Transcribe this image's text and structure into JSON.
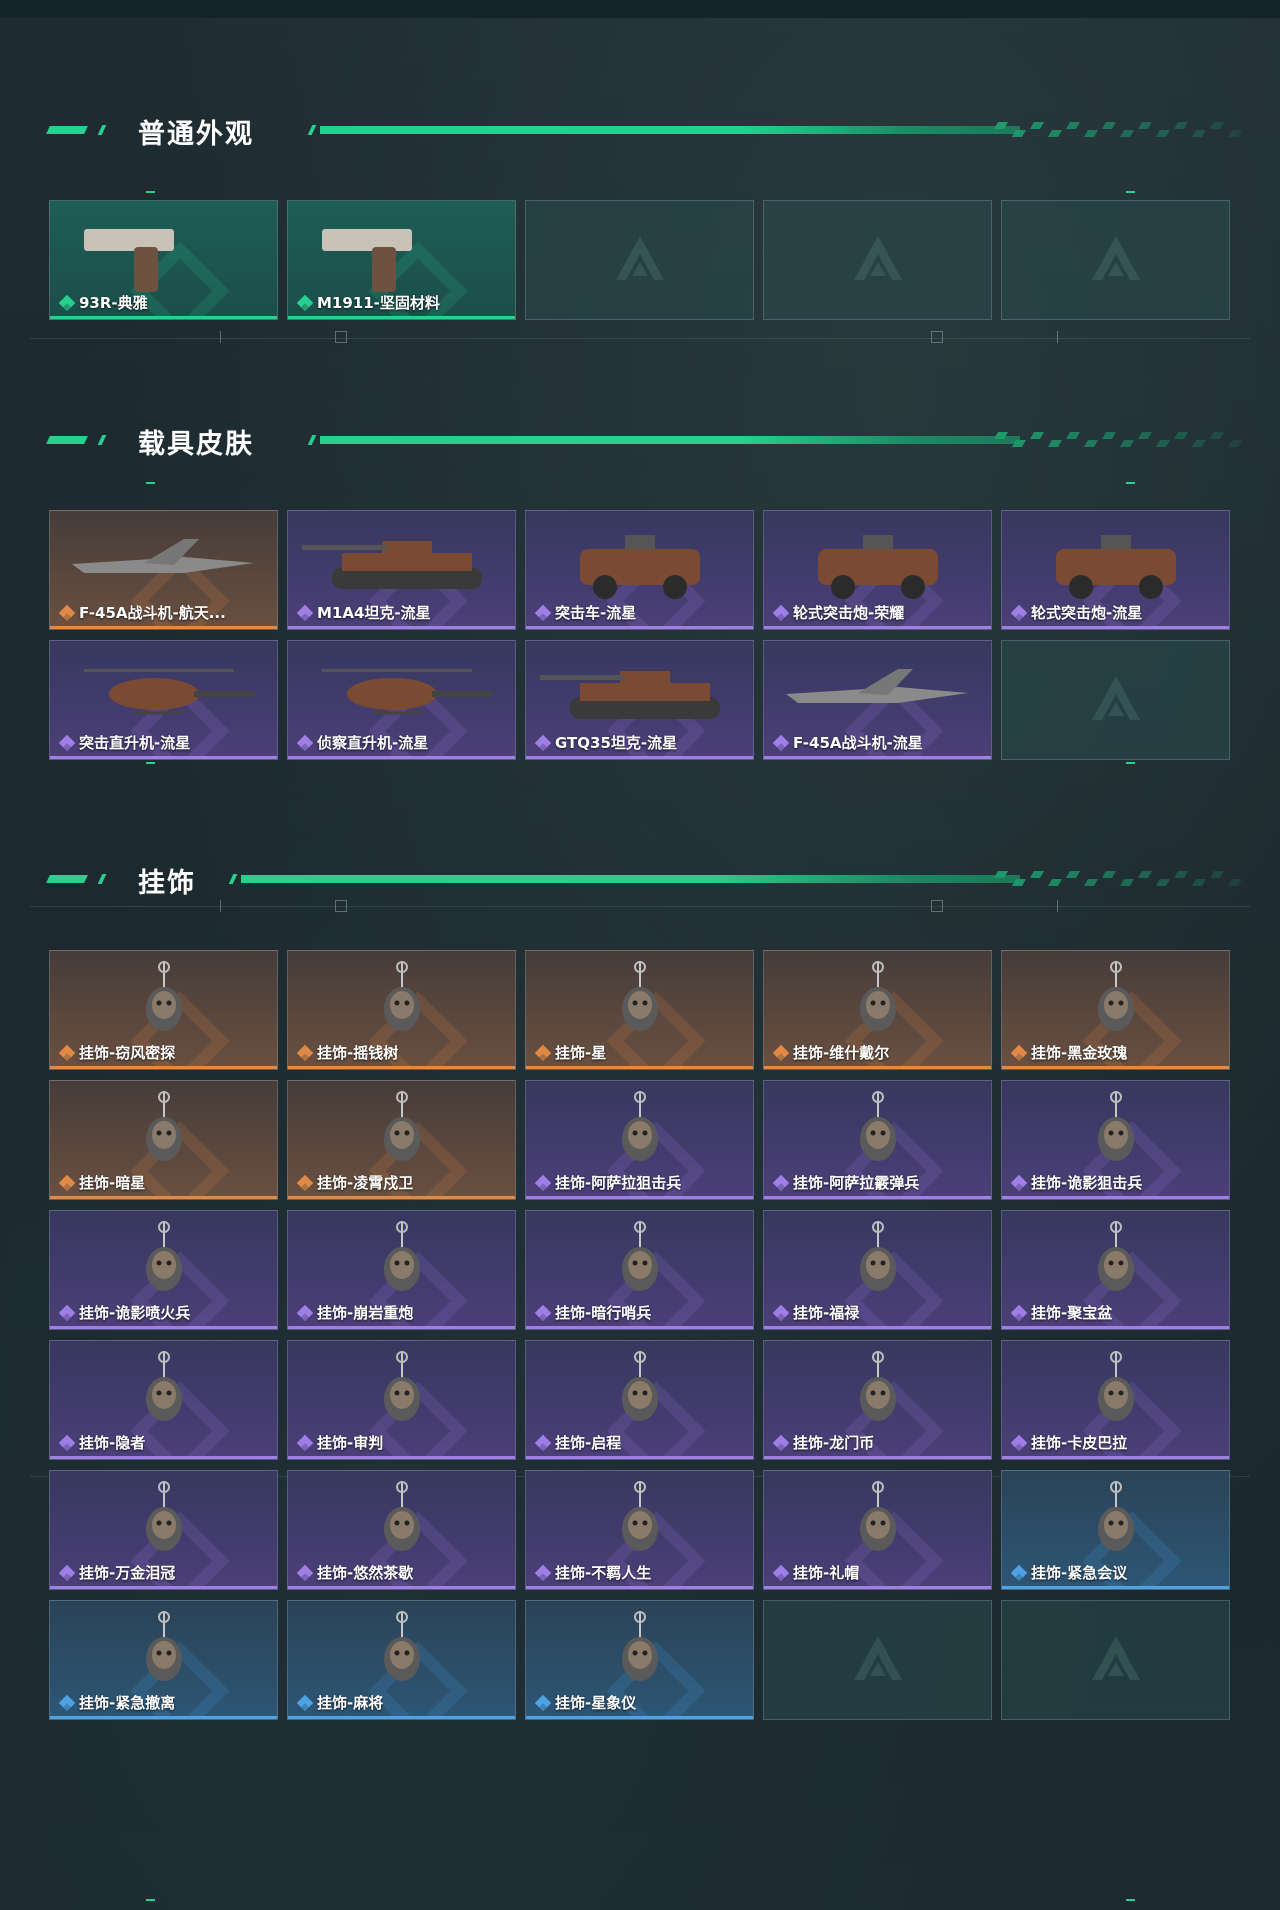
{
  "sections": [
    {
      "title": "普通外观"
    },
    {
      "title": "载具皮肤"
    },
    {
      "title": "挂饰"
    }
  ],
  "rarity_colors": {
    "green": "#27d08e",
    "gold": "#e08a45",
    "purple": "#9f7fe6",
    "blue": "#4da3e6"
  },
  "weapon_skins": [
    {
      "name": "93R-典雅",
      "rarity": "green",
      "icon": "pistol-icon"
    },
    {
      "name": "M1911-坚固材料",
      "rarity": "green",
      "icon": "pistol-icon"
    },
    {
      "name": "",
      "rarity": "empty"
    },
    {
      "name": "",
      "rarity": "empty"
    },
    {
      "name": "",
      "rarity": "empty"
    }
  ],
  "vehicle_skins": [
    {
      "name": "F-45A战斗机-航天...",
      "rarity": "gold",
      "icon": "jet-icon"
    },
    {
      "name": "M1A4坦克-流星",
      "rarity": "purple",
      "icon": "tank-icon"
    },
    {
      "name": "突击车-流星",
      "rarity": "purple",
      "icon": "truck-icon"
    },
    {
      "name": "轮式突击炮-荣耀",
      "rarity": "purple",
      "icon": "armored-car-icon"
    },
    {
      "name": "轮式突击炮-流星",
      "rarity": "purple",
      "icon": "armored-car-icon"
    },
    {
      "name": "突击直升机-流星",
      "rarity": "purple",
      "icon": "helicopter-icon"
    },
    {
      "name": "侦察直升机-流星",
      "rarity": "purple",
      "icon": "helicopter-icon"
    },
    {
      "name": "GTQ35坦克-流星",
      "rarity": "purple",
      "icon": "tank-icon"
    },
    {
      "name": "F-45A战斗机-流星",
      "rarity": "purple",
      "icon": "jet-icon"
    },
    {
      "name": "",
      "rarity": "empty"
    }
  ],
  "charms": [
    {
      "name": "挂饰-窃风密探",
      "rarity": "gold"
    },
    {
      "name": "挂饰-摇钱树",
      "rarity": "gold"
    },
    {
      "name": "挂饰-星",
      "rarity": "gold"
    },
    {
      "name": "挂饰-维什戴尔",
      "rarity": "gold"
    },
    {
      "name": "挂饰-黑金玫瑰",
      "rarity": "gold"
    },
    {
      "name": "挂饰-暗星",
      "rarity": "gold"
    },
    {
      "name": "挂饰-凌霄戍卫",
      "rarity": "gold"
    },
    {
      "name": "挂饰-阿萨拉狙击兵",
      "rarity": "purple"
    },
    {
      "name": "挂饰-阿萨拉霰弹兵",
      "rarity": "purple"
    },
    {
      "name": "挂饰-诡影狙击兵",
      "rarity": "purple"
    },
    {
      "name": "挂饰-诡影喷火兵",
      "rarity": "purple"
    },
    {
      "name": "挂饰-崩岩重炮",
      "rarity": "purple"
    },
    {
      "name": "挂饰-暗行哨兵",
      "rarity": "purple"
    },
    {
      "name": "挂饰-福禄",
      "rarity": "purple"
    },
    {
      "name": "挂饰-聚宝盆",
      "rarity": "purple"
    },
    {
      "name": "挂饰-隐者",
      "rarity": "purple"
    },
    {
      "name": "挂饰-审判",
      "rarity": "purple"
    },
    {
      "name": "挂饰-启程",
      "rarity": "purple"
    },
    {
      "name": "挂饰-龙门币",
      "rarity": "purple"
    },
    {
      "name": "挂饰-卡皮巴拉",
      "rarity": "purple"
    },
    {
      "name": "挂饰-万金泪冠",
      "rarity": "purple"
    },
    {
      "name": "挂饰-悠然茶歇",
      "rarity": "purple"
    },
    {
      "name": "挂饰-不羁人生",
      "rarity": "purple"
    },
    {
      "name": "挂饰-礼帽",
      "rarity": "purple"
    },
    {
      "name": "挂饰-紧急会议",
      "rarity": "blue"
    },
    {
      "name": "挂饰-紧急撤离",
      "rarity": "blue"
    },
    {
      "name": "挂饰-麻将",
      "rarity": "blue"
    },
    {
      "name": "挂饰-星象仪",
      "rarity": "blue"
    },
    {
      "name": "",
      "rarity": "empty"
    },
    {
      "name": "",
      "rarity": "empty"
    }
  ]
}
